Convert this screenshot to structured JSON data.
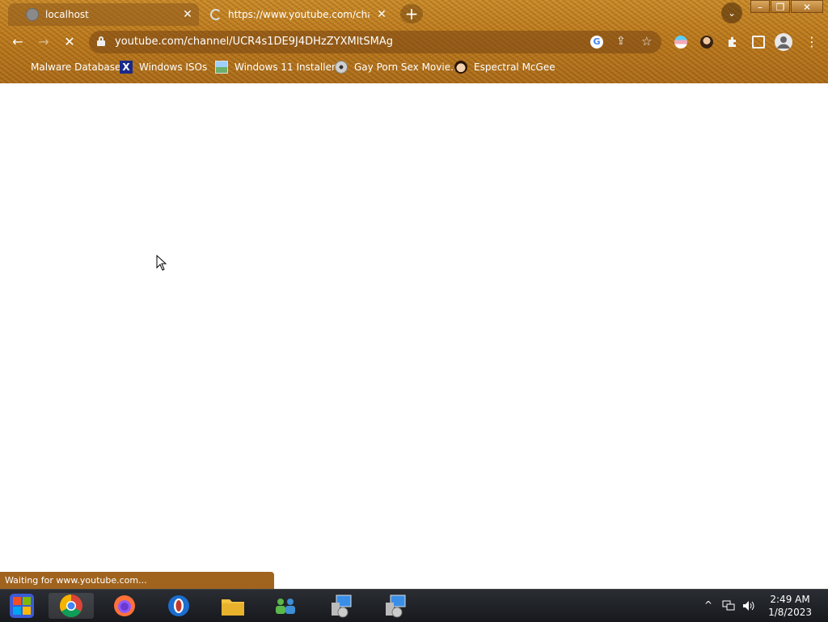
{
  "browser": {
    "tabs": [
      {
        "title": "localhost",
        "close": "✕"
      },
      {
        "title": "https://www.youtube.com/channe",
        "close": "✕"
      }
    ],
    "new_tab": "+",
    "tab_search": "⌄",
    "window_controls": {
      "minimize": "–",
      "maximize": "❐",
      "close": "✕"
    },
    "nav": {
      "back": "←",
      "forward": "→",
      "stop": "✕",
      "menu": "⋮"
    },
    "address_bar": {
      "url": "youtube.com/channel/UCR4s1DE9J4DHzZYXMltSMAg",
      "google_label": "G",
      "share": "⇪",
      "star": "☆"
    },
    "bookmarks": [
      {
        "label": "Malware Database",
        "icon": "bookmark-malware-icon"
      },
      {
        "label": "Windows ISOs",
        "icon": "x-logo-icon"
      },
      {
        "label": "Windows 11 Installer",
        "icon": "image-icon"
      },
      {
        "label": "Gay Porn Sex Movie...",
        "icon": "disc-icon"
      },
      {
        "label": "Espectral McGee",
        "icon": "face-icon"
      }
    ],
    "status_text": "Waiting for www.youtube.com..."
  },
  "taskbar": {
    "apps": [
      {
        "name": "start-button"
      },
      {
        "name": "chrome"
      },
      {
        "name": "firefox"
      },
      {
        "name": "opera"
      },
      {
        "name": "file-explorer"
      },
      {
        "name": "network-people"
      },
      {
        "name": "installer-1"
      },
      {
        "name": "installer-2"
      }
    ],
    "tray": {
      "chevron": "^"
    },
    "clock": {
      "time": "2:49 AM",
      "date": "1/8/2023"
    }
  },
  "colors": {
    "theme_amber": "#b8761c",
    "status_brown": "#a0641e",
    "taskbar": "#1e2024"
  }
}
